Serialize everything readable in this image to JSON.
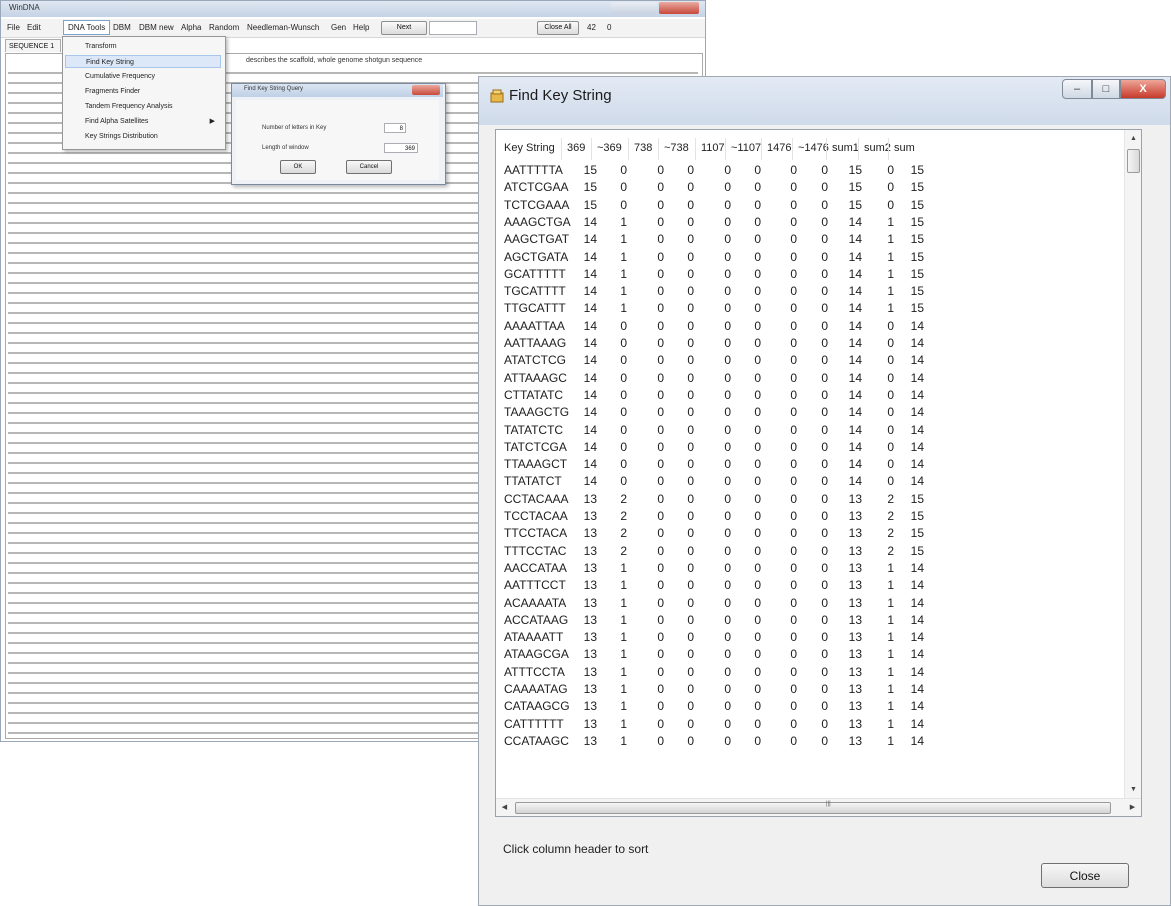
{
  "main_window": {
    "title": "WinDNA",
    "menu": {
      "file": "File",
      "edit": "Edit",
      "dna_tools": "DNA Tools",
      "dbm": "DBM",
      "dbm_new": "DBM new",
      "alpha": "Alpha",
      "random": "Random",
      "needleman": "Needleman-Wunsch",
      "gen": "Gen",
      "help": "Help",
      "btn1": "Next",
      "btn2": "Close All",
      "field1": "42",
      "field2": "0"
    },
    "file_tab": "SEQUENCE 1",
    "sequence_header": "describes the scaffold, whole genome shotgun sequence"
  },
  "dna_menu": {
    "items": [
      {
        "label": "Transform"
      },
      {
        "label": "Find Key String"
      },
      {
        "label": "Cumulative Frequency"
      },
      {
        "label": "Fragments Finder"
      },
      {
        "label": "Tandem Frequency Analysis"
      },
      {
        "label": "Find Alpha Satellites"
      },
      {
        "label": "Key Strings Distribution"
      }
    ]
  },
  "small_dialog": {
    "title": "Find Key String Query",
    "label1": "Number of letters in Key",
    "value1": "8",
    "label2": "Length of window",
    "value2": "369",
    "ok": "OK",
    "cancel": "Cancel"
  },
  "fks": {
    "title": "Find Key String",
    "columns": [
      "Key String",
      "369",
      "~369",
      "738",
      "~738",
      "1107",
      "~1107",
      "1476",
      "~1476",
      "sum1",
      "sum2",
      "sum"
    ],
    "rows": [
      [
        "AATTTTTA",
        "15",
        "0",
        "0",
        "0",
        "0",
        "0",
        "0",
        "0",
        "15",
        "0",
        "15"
      ],
      [
        "ATCTCGAA",
        "15",
        "0",
        "0",
        "0",
        "0",
        "0",
        "0",
        "0",
        "15",
        "0",
        "15"
      ],
      [
        "TCTCGAAA",
        "15",
        "0",
        "0",
        "0",
        "0",
        "0",
        "0",
        "0",
        "15",
        "0",
        "15"
      ],
      [
        "AAAGCTGA",
        "14",
        "1",
        "0",
        "0",
        "0",
        "0",
        "0",
        "0",
        "14",
        "1",
        "15"
      ],
      [
        "AAGCTGAT",
        "14",
        "1",
        "0",
        "0",
        "0",
        "0",
        "0",
        "0",
        "14",
        "1",
        "15"
      ],
      [
        "AGCTGATA",
        "14",
        "1",
        "0",
        "0",
        "0",
        "0",
        "0",
        "0",
        "14",
        "1",
        "15"
      ],
      [
        "GCATTTTT",
        "14",
        "1",
        "0",
        "0",
        "0",
        "0",
        "0",
        "0",
        "14",
        "1",
        "15"
      ],
      [
        "TGCATTTT",
        "14",
        "1",
        "0",
        "0",
        "0",
        "0",
        "0",
        "0",
        "14",
        "1",
        "15"
      ],
      [
        "TTGCATTT",
        "14",
        "1",
        "0",
        "0",
        "0",
        "0",
        "0",
        "0",
        "14",
        "1",
        "15"
      ],
      [
        "AAAATTAA",
        "14",
        "0",
        "0",
        "0",
        "0",
        "0",
        "0",
        "0",
        "14",
        "0",
        "14"
      ],
      [
        "AATTAAAG",
        "14",
        "0",
        "0",
        "0",
        "0",
        "0",
        "0",
        "0",
        "14",
        "0",
        "14"
      ],
      [
        "ATATCTCG",
        "14",
        "0",
        "0",
        "0",
        "0",
        "0",
        "0",
        "0",
        "14",
        "0",
        "14"
      ],
      [
        "ATTAAAGC",
        "14",
        "0",
        "0",
        "0",
        "0",
        "0",
        "0",
        "0",
        "14",
        "0",
        "14"
      ],
      [
        "CTTATATC",
        "14",
        "0",
        "0",
        "0",
        "0",
        "0",
        "0",
        "0",
        "14",
        "0",
        "14"
      ],
      [
        "TAAAGCTG",
        "14",
        "0",
        "0",
        "0",
        "0",
        "0",
        "0",
        "0",
        "14",
        "0",
        "14"
      ],
      [
        "TATATCTC",
        "14",
        "0",
        "0",
        "0",
        "0",
        "0",
        "0",
        "0",
        "14",
        "0",
        "14"
      ],
      [
        "TATCTCGA",
        "14",
        "0",
        "0",
        "0",
        "0",
        "0",
        "0",
        "0",
        "14",
        "0",
        "14"
      ],
      [
        "TTAAAGCT",
        "14",
        "0",
        "0",
        "0",
        "0",
        "0",
        "0",
        "0",
        "14",
        "0",
        "14"
      ],
      [
        "TTATATCT",
        "14",
        "0",
        "0",
        "0",
        "0",
        "0",
        "0",
        "0",
        "14",
        "0",
        "14"
      ],
      [
        "CCTACAAA",
        "13",
        "2",
        "0",
        "0",
        "0",
        "0",
        "0",
        "0",
        "13",
        "2",
        "15"
      ],
      [
        "TCCTACAA",
        "13",
        "2",
        "0",
        "0",
        "0",
        "0",
        "0",
        "0",
        "13",
        "2",
        "15"
      ],
      [
        "TTCCTACA",
        "13",
        "2",
        "0",
        "0",
        "0",
        "0",
        "0",
        "0",
        "13",
        "2",
        "15"
      ],
      [
        "TTTCCTAC",
        "13",
        "2",
        "0",
        "0",
        "0",
        "0",
        "0",
        "0",
        "13",
        "2",
        "15"
      ],
      [
        "AACCATAA",
        "13",
        "1",
        "0",
        "0",
        "0",
        "0",
        "0",
        "0",
        "13",
        "1",
        "14"
      ],
      [
        "AATTTCCT",
        "13",
        "1",
        "0",
        "0",
        "0",
        "0",
        "0",
        "0",
        "13",
        "1",
        "14"
      ],
      [
        "ACAAAATA",
        "13",
        "1",
        "0",
        "0",
        "0",
        "0",
        "0",
        "0",
        "13",
        "1",
        "14"
      ],
      [
        "ACCATAAG",
        "13",
        "1",
        "0",
        "0",
        "0",
        "0",
        "0",
        "0",
        "13",
        "1",
        "14"
      ],
      [
        "ATAAAATT",
        "13",
        "1",
        "0",
        "0",
        "0",
        "0",
        "0",
        "0",
        "13",
        "1",
        "14"
      ],
      [
        "ATAAGCGA",
        "13",
        "1",
        "0",
        "0",
        "0",
        "0",
        "0",
        "0",
        "13",
        "1",
        "14"
      ],
      [
        "ATTTCCTA",
        "13",
        "1",
        "0",
        "0",
        "0",
        "0",
        "0",
        "0",
        "13",
        "1",
        "14"
      ],
      [
        "CAAAATAG",
        "13",
        "1",
        "0",
        "0",
        "0",
        "0",
        "0",
        "0",
        "13",
        "1",
        "14"
      ],
      [
        "CATAAGCG",
        "13",
        "1",
        "0",
        "0",
        "0",
        "0",
        "0",
        "0",
        "13",
        "1",
        "14"
      ],
      [
        "CATTTTTT",
        "13",
        "1",
        "0",
        "0",
        "0",
        "0",
        "0",
        "0",
        "13",
        "1",
        "14"
      ],
      [
        "CCATAAGC",
        "13",
        "1",
        "0",
        "0",
        "0",
        "0",
        "0",
        "0",
        "13",
        "1",
        "14"
      ]
    ],
    "status": "Click column header to sort",
    "close_label": "Close",
    "min_glyph": "–",
    "max_glyph": "□",
    "close_glyph": "X"
  }
}
